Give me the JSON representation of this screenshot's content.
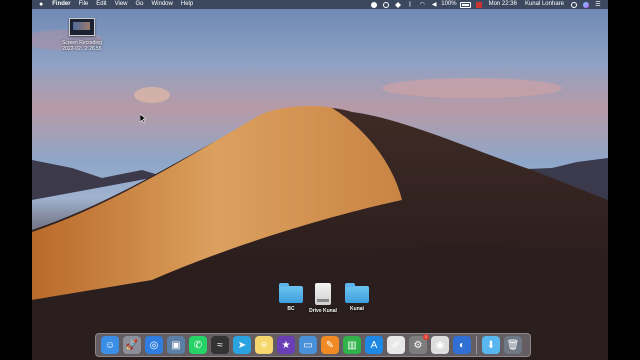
{
  "menubar": {
    "app_name": "Finder",
    "menus": [
      "File",
      "Edit",
      "View",
      "Go",
      "Window",
      "Help"
    ],
    "battery": "100%",
    "clock": "Mon 22:36",
    "user": "Kunal Lonhare"
  },
  "desktop_file": {
    "line1": "Screen Recording",
    "line2": "2022-02...2.26.55"
  },
  "folders": [
    {
      "label": "BC",
      "icon": "folder-icon"
    },
    {
      "label": "Drive Kunal",
      "icon": "drive-icon"
    },
    {
      "label": "Kunal",
      "icon": "folder-icon"
    }
  ],
  "dock": {
    "apps": [
      {
        "name": "finder-icon",
        "color": "#3a8ee6",
        "glyph": "☺"
      },
      {
        "name": "launchpad-icon",
        "color": "#8b8f99",
        "glyph": "🚀"
      },
      {
        "name": "safari-icon",
        "color": "#2f7de0",
        "glyph": "◎"
      },
      {
        "name": "preview-icon",
        "color": "#5b7fa6",
        "glyph": "▣"
      },
      {
        "name": "whatsapp-icon",
        "color": "#25d366",
        "glyph": "✆"
      },
      {
        "name": "activity-monitor-icon",
        "color": "#333333",
        "glyph": "≈"
      },
      {
        "name": "telegram-icon",
        "color": "#2aa3e0",
        "glyph": "➤"
      },
      {
        "name": "notes-icon",
        "color": "#f5d76e",
        "glyph": "≡"
      },
      {
        "name": "imovie-icon",
        "color": "#6a3fb5",
        "glyph": "★"
      },
      {
        "name": "keynote-icon",
        "color": "#4a90d9",
        "glyph": "▭"
      },
      {
        "name": "pages-icon",
        "color": "#f08a24",
        "glyph": "✎"
      },
      {
        "name": "numbers-icon",
        "color": "#2fb34a",
        "glyph": "▥"
      },
      {
        "name": "app-store-icon",
        "color": "#1e88e5",
        "glyph": "A"
      },
      {
        "name": "textedit-icon",
        "color": "#e8e8e8",
        "glyph": "✐"
      },
      {
        "name": "system-preferences-icon",
        "color": "#7d7d7d",
        "glyph": "⚙",
        "badge": "1"
      },
      {
        "name": "chrome-icon",
        "color": "#dddddd",
        "glyph": "◉"
      },
      {
        "name": "quicktime-icon",
        "color": "#2f6fd6",
        "glyph": "◐"
      }
    ],
    "right": [
      {
        "name": "downloads-folder-icon",
        "color": "#58b7ee",
        "glyph": "⬇"
      },
      {
        "name": "trash-icon",
        "color": "#6f7885",
        "glyph": "🗑"
      }
    ]
  }
}
